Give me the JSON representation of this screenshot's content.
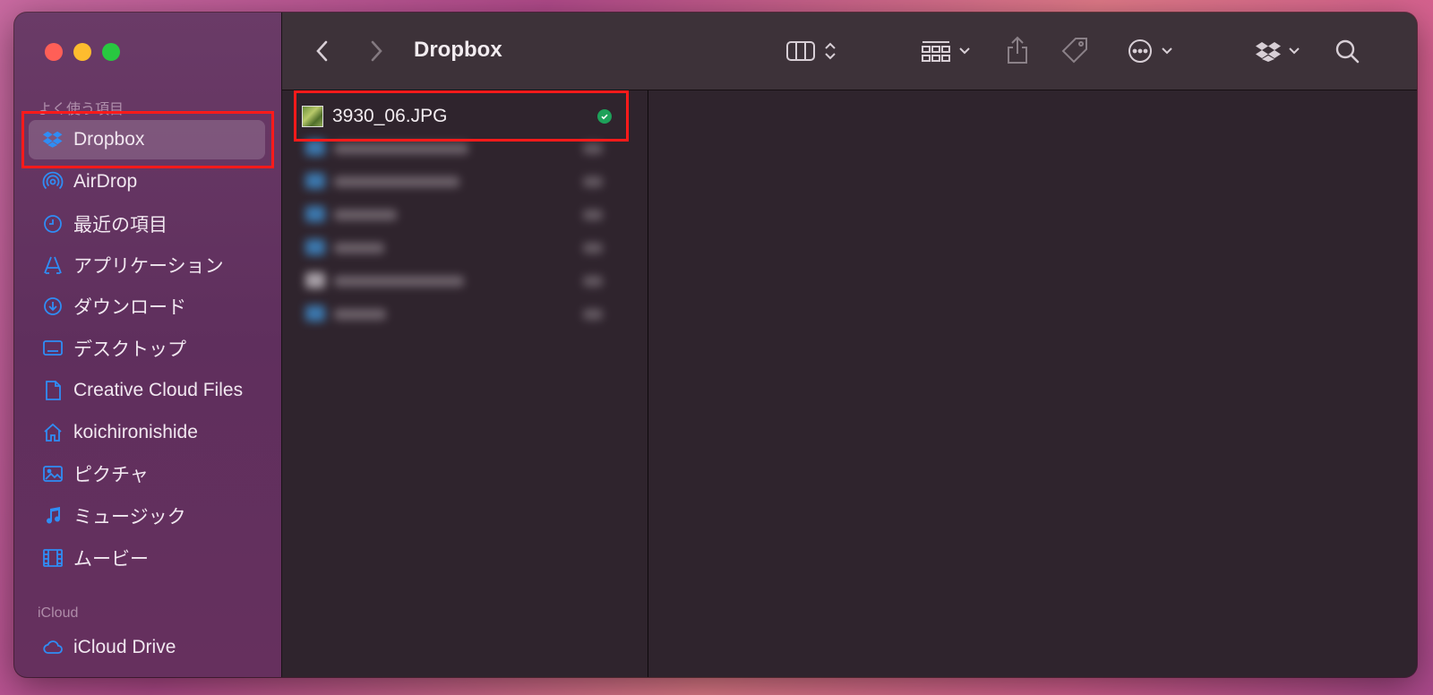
{
  "window": {
    "title": "Dropbox"
  },
  "sidebar": {
    "favorites_label": "よく使う項目",
    "items": [
      {
        "label": "Dropbox",
        "icon": "dropbox-icon"
      },
      {
        "label": "AirDrop",
        "icon": "airdrop-icon"
      },
      {
        "label": "最近の項目",
        "icon": "clock-icon"
      },
      {
        "label": "アプリケーション",
        "icon": "applications-icon"
      },
      {
        "label": "ダウンロード",
        "icon": "download-icon"
      },
      {
        "label": "デスクトップ",
        "icon": "desktop-icon"
      },
      {
        "label": "Creative Cloud Files",
        "icon": "document-icon"
      },
      {
        "label": "koichironishide",
        "icon": "home-icon"
      },
      {
        "label": "ピクチャ",
        "icon": "photo-icon"
      },
      {
        "label": "ミュージック",
        "icon": "music-icon"
      },
      {
        "label": "ムービー",
        "icon": "film-icon"
      }
    ],
    "icloud_label": "iCloud",
    "icloud_items": [
      {
        "label": "iCloud Drive",
        "icon": "cloud-icon"
      }
    ]
  },
  "toolbar": {
    "title": "Dropbox"
  },
  "files": [
    {
      "name": "3930_06.JPG",
      "status": "synced"
    }
  ],
  "colors": {
    "sidebar_accent": "#2f8df5",
    "highlight": "#ff1a1a",
    "sync_green": "#1ea15a"
  }
}
